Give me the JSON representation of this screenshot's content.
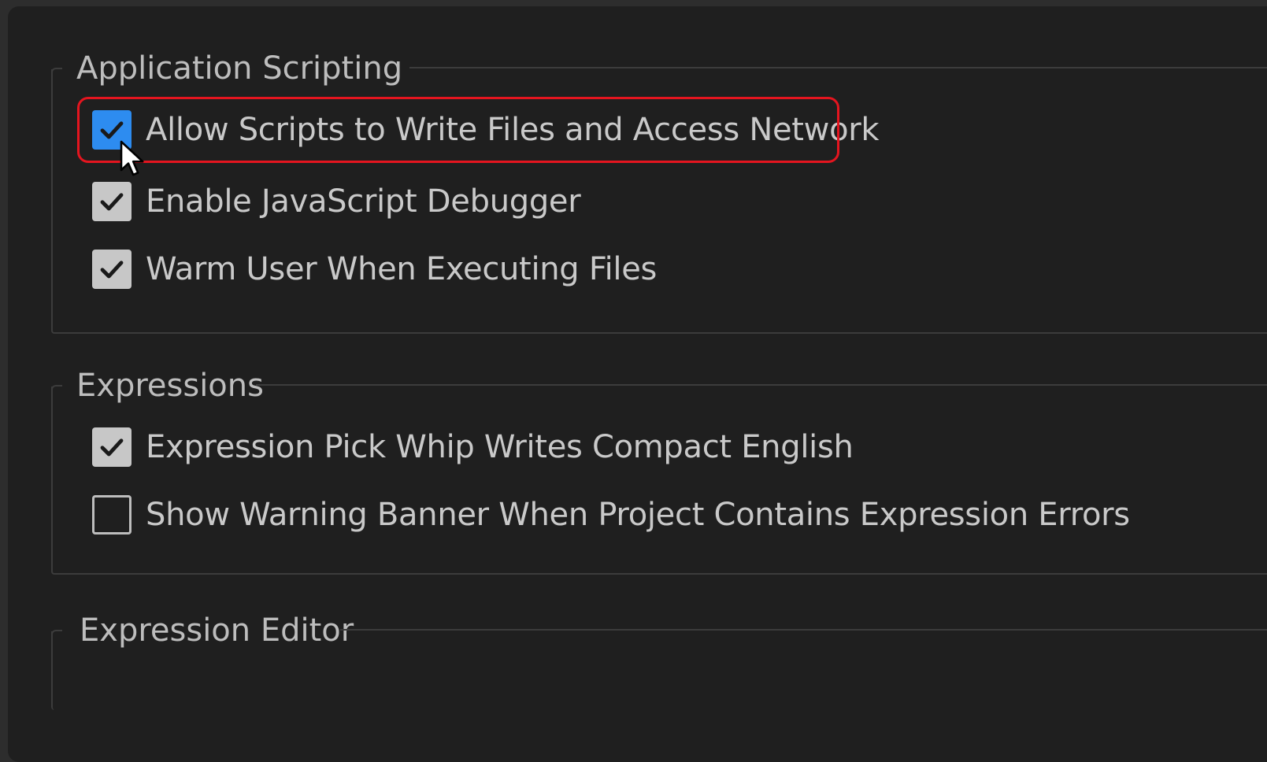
{
  "sections": [
    {
      "title": "Application Scripting",
      "options": [
        {
          "label": "Allow Scripts to Write Files and Access Network",
          "checked": true,
          "focused": true
        },
        {
          "label": "Enable JavaScript Debugger",
          "checked": true
        },
        {
          "label": "Warm User When Executing Files",
          "checked": true
        }
      ]
    },
    {
      "title": "Expressions",
      "options": [
        {
          "label": "Expression Pick Whip Writes Compact English",
          "checked": true
        },
        {
          "label": "Show Warning Banner When Project Contains Expression Errors",
          "checked": false
        }
      ]
    },
    {
      "title": "Expression Editor",
      "options": []
    }
  ],
  "colors": {
    "panel_bg": "#1f1f1f",
    "checkbox_accent": "#2d8cf0",
    "highlight": "#e4151f",
    "text": "#c9c9c9"
  },
  "icons": {
    "check": "checkmark-icon",
    "cursor": "mouse-pointer-icon"
  }
}
